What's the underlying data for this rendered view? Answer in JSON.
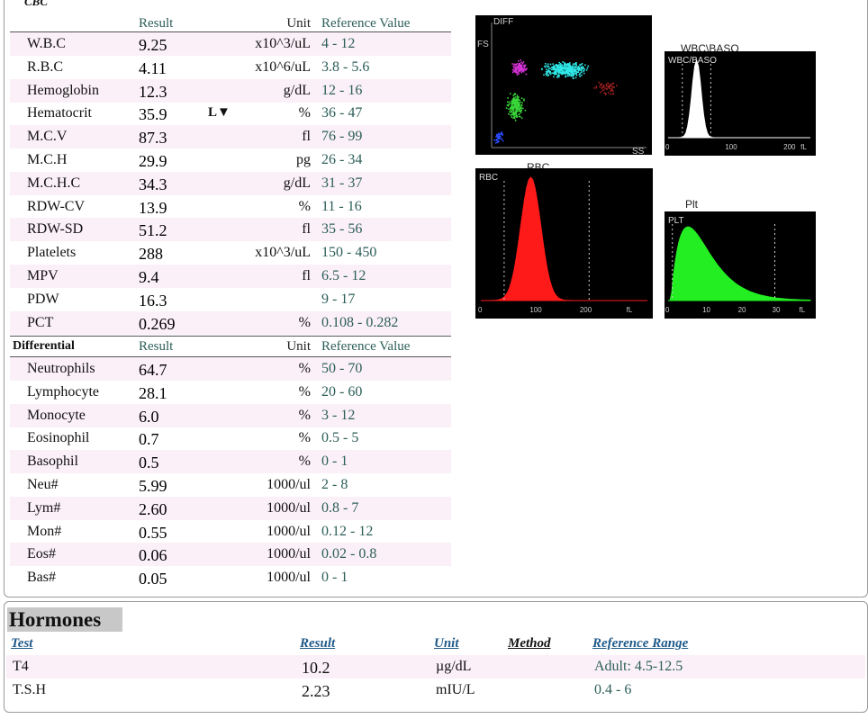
{
  "cbc": {
    "section_label": "CBC",
    "headers": {
      "result": "Result",
      "unit": "Unit",
      "reference": "Reference Value"
    },
    "rows": [
      {
        "name": "W.B.C",
        "result": "9.25",
        "flag": "",
        "unit": "x10^3/uL",
        "reference": "4 - 12"
      },
      {
        "name": "R.B.C",
        "result": "4.11",
        "flag": "",
        "unit": "x10^6/uL",
        "reference": "3.8 - 5.6"
      },
      {
        "name": "Hemoglobin",
        "result": "12.3",
        "flag": "",
        "unit": "g/dL",
        "reference": "12 - 16"
      },
      {
        "name": "Hematocrit",
        "result": "35.9",
        "flag": "L▼",
        "unit": "%",
        "reference": "36 - 47"
      },
      {
        "name": "M.C.V",
        "result": "87.3",
        "flag": "",
        "unit": "fl",
        "reference": "76 - 99"
      },
      {
        "name": "M.C.H",
        "result": "29.9",
        "flag": "",
        "unit": "pg",
        "reference": "26 - 34"
      },
      {
        "name": "M.C.H.C",
        "result": "34.3",
        "flag": "",
        "unit": "g/dL",
        "reference": "31 - 37"
      },
      {
        "name": "RDW-CV",
        "result": "13.9",
        "flag": "",
        "unit": "%",
        "reference": "11 - 16"
      },
      {
        "name": "RDW-SD",
        "result": "51.2",
        "flag": "",
        "unit": "fl",
        "reference": "35 - 56"
      },
      {
        "name": "Platelets",
        "result": "288",
        "flag": "",
        "unit": "x10^3/uL",
        "reference": "150 - 450"
      },
      {
        "name": "MPV",
        "result": "9.4",
        "flag": "",
        "unit": "fl",
        "reference": "6.5 - 12"
      },
      {
        "name": "PDW",
        "result": "16.3",
        "flag": "",
        "unit": "",
        "reference": "9 - 17"
      },
      {
        "name": "PCT",
        "result": "0.269",
        "flag": "",
        "unit": "%",
        "reference": "0.108 - 0.282"
      }
    ]
  },
  "differential": {
    "section_label": "Differential",
    "headers": {
      "result": "Result",
      "unit": "Unit",
      "reference": "Reference Value"
    },
    "rows": [
      {
        "name": "Neutrophils",
        "result": "64.7",
        "unit": "%",
        "reference": "50 - 70"
      },
      {
        "name": "Lymphocyte",
        "result": "28.1",
        "unit": "%",
        "reference": "20 - 60"
      },
      {
        "name": "Monocyte",
        "result": "6.0",
        "unit": "%",
        "reference": "3 - 12"
      },
      {
        "name": "Eosinophil",
        "result": "0.7",
        "unit": "%",
        "reference": "0.5 - 5"
      },
      {
        "name": "Basophil",
        "result": "0.5",
        "unit": "%",
        "reference": "0 - 1"
      },
      {
        "name": "Neu#",
        "result": "5.99",
        "unit": "1000/ul",
        "reference": "2 - 8"
      },
      {
        "name": "Lym#",
        "result": "2.60",
        "unit": "1000/ul",
        "reference": "0.8 - 7"
      },
      {
        "name": "Mon#",
        "result": "0.55",
        "unit": "1000/ul",
        "reference": "0.12 - 12"
      },
      {
        "name": "Eos#",
        "result": "0.06",
        "unit": "1000/ul",
        "reference": "0.02 - 0.8"
      },
      {
        "name": "Bas#",
        "result": "0.05",
        "unit": "1000/ul",
        "reference": "0 - 1"
      }
    ]
  },
  "plots": {
    "diff": {
      "label": "DIFF",
      "y_label": "FS",
      "x_label": "SS"
    },
    "wbc_baso": {
      "caption": "WBC\\BASO",
      "label": "WBC/BASO",
      "ticks": [
        "0",
        "100",
        "200",
        "fL"
      ]
    },
    "rbc": {
      "caption": "RBC",
      "label": "RBC",
      "ticks": [
        "0",
        "100",
        "200",
        "fL"
      ]
    },
    "plt": {
      "caption": "Plt",
      "label": "PLT",
      "ticks": [
        "0",
        "10",
        "20",
        "30",
        "fL"
      ]
    },
    "colors": {
      "rbc": "#ff1a1a",
      "plt": "#22ee22",
      "wbc": "#ffffff",
      "diff_neut": "#30e8e8",
      "diff_lymph": "#39d639",
      "diff_mono": "#d633d6"
    }
  },
  "hormones": {
    "title": "Hormones",
    "headers": {
      "test": "Test",
      "result": "Result",
      "unit": "Unit",
      "method": "Method",
      "reference": "Reference Range"
    },
    "rows": [
      {
        "test": "T4",
        "result": "10.2",
        "unit": "µg/dL",
        "method": "",
        "reference": "Adult: 4.5-12.5"
      },
      {
        "test": "T.S.H",
        "result": "2.23",
        "unit": "mIU/L",
        "method": "",
        "reference": "0.4 - 6"
      }
    ]
  }
}
